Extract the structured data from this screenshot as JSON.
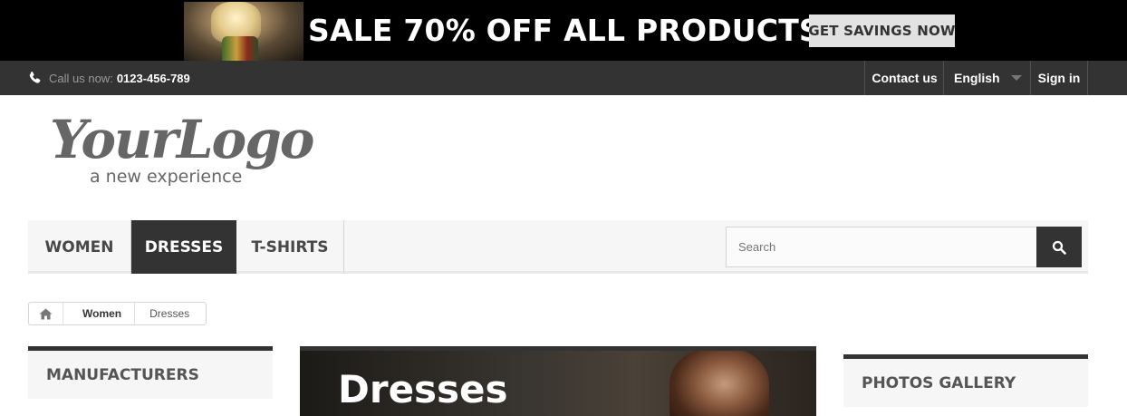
{
  "banner": {
    "title": "SALE 70% OFF ALL PRODUCTS",
    "button_label": "GET SAVINGS NOW"
  },
  "topbar": {
    "call_label": "Call us now:",
    "phone_number": "0123-456-789",
    "contact_label": "Contact us",
    "language": "English",
    "signin_label": "Sign in"
  },
  "logo": {
    "script_text": "YourLogo",
    "tagline": "a new experience"
  },
  "menu": {
    "items": [
      {
        "label": "WOMEN"
      },
      {
        "label": "DRESSES",
        "active": true
      },
      {
        "label": "T-SHIRTS"
      }
    ],
    "search_placeholder": "Search"
  },
  "breadcrumb": {
    "items": [
      "Women",
      "Dresses"
    ]
  },
  "left_column": {
    "heading": "MANUFACTURERS"
  },
  "category": {
    "title": "Dresses"
  },
  "right_column": {
    "heading": "PHOTOS GALLERY"
  },
  "colors": {
    "banner_bg": "#000000",
    "topbar_bg": "#333333",
    "menu_active_bg": "#333333",
    "menu_bg": "#f6f6f6"
  },
  "icons": {
    "phone": "phone-icon",
    "search": "search-icon",
    "home": "home-icon",
    "caret": "caret-down-icon"
  }
}
